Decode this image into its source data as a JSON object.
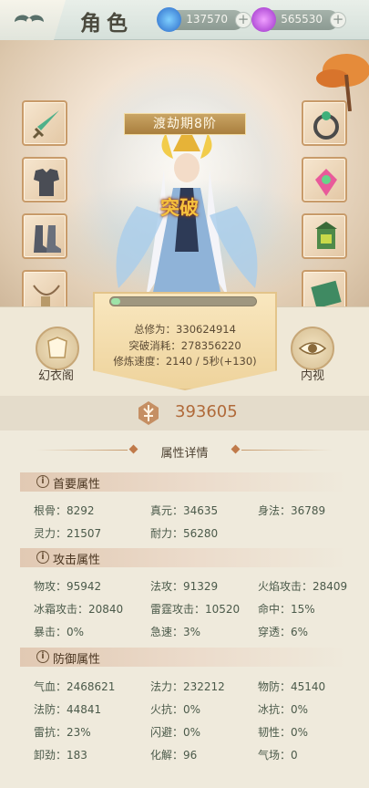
{
  "header": {
    "title": "角色",
    "currency_blue": "137570",
    "currency_purple": "565530"
  },
  "realm": "渡劫期8阶",
  "character_banner": "突破",
  "cultivation": {
    "total_label": "总修为：330624914",
    "cost_label": "突破消耗：278356220",
    "speed_label": "修炼速度：2140 / 5秒(+130)",
    "progress_fraction": 0.04
  },
  "buttons": {
    "wardrobe": "幻衣阁",
    "inner_view": "内视"
  },
  "combat_power": "393605",
  "details_title": "属性详情",
  "sections": [
    {
      "title": "首要属性",
      "stats": [
        "根骨：8292",
        "真元：34635",
        "身法：36789",
        "灵力：21507",
        "耐力：56280"
      ]
    },
    {
      "title": "攻击属性",
      "stats": [
        "物攻：95942",
        "法攻：91329",
        "火焰攻击：28409",
        "冰霜攻击：20840",
        "雷霆攻击：10520",
        "命中：15%",
        "暴击：0%",
        "急速：3%",
        "穿透：6%"
      ]
    },
    {
      "title": "防御属性",
      "stats": [
        "气血：2468621",
        "法力：232212",
        "物防：45140",
        "法防：44841",
        "火抗：0%",
        "冰抗：0%",
        "雷抗：23%",
        "闪避：0%",
        "韧性：0%",
        "卸劲：183",
        "化解：96",
        "气场：0"
      ]
    }
  ],
  "equipment_slots": {
    "left": [
      "sword-icon",
      "armor-icon",
      "boots-icon",
      "necklace-icon"
    ],
    "right": [
      "ring-icon",
      "gem-icon",
      "lantern-icon",
      "scroll-icon"
    ]
  },
  "colors": {
    "accent_gold": "#c9a464",
    "power_text": "#b06a3a",
    "stat_text": "#4b5a4a"
  }
}
